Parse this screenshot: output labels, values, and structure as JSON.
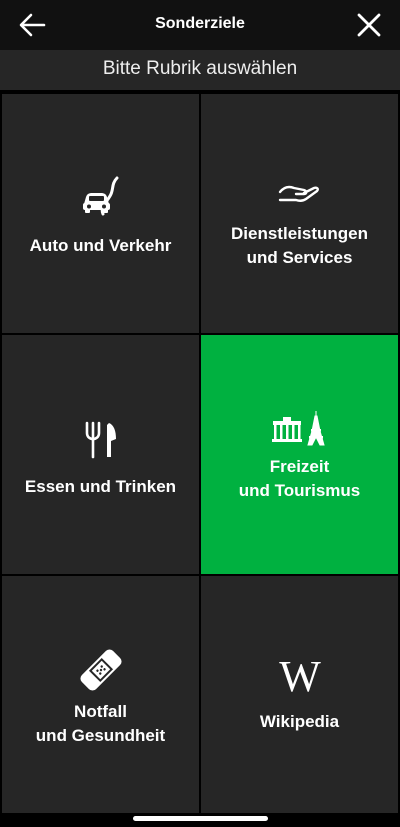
{
  "header": {
    "title": "Sonderziele",
    "back_icon": "arrow-left-icon",
    "close_icon": "close-icon"
  },
  "subtitle": "Bitte Rubrik auswählen",
  "tiles": [
    {
      "id": "auto",
      "icon": "car-road-icon",
      "lines": [
        "Auto und Verkehr"
      ],
      "active": false
    },
    {
      "id": "dienst",
      "icon": "hand-icon",
      "lines": [
        "Dienstleistungen",
        "und Services"
      ],
      "active": false
    },
    {
      "id": "essen",
      "icon": "fork-knife-icon",
      "lines": [
        "Essen und Trinken"
      ],
      "active": false
    },
    {
      "id": "freizeit",
      "icon": "landmarks-icon",
      "lines": [
        "Freizeit",
        "und Tourismus"
      ],
      "active": true
    },
    {
      "id": "notfall",
      "icon": "bandage-icon",
      "lines": [
        "Notfall",
        "und Gesundheit"
      ],
      "active": false
    },
    {
      "id": "wiki",
      "icon": "wikipedia-icon",
      "lines": [
        "Wikipedia"
      ],
      "active": false
    }
  ],
  "colors": {
    "tile": "#262626",
    "active_tile": "#00b140",
    "topbar": "#111111",
    "subtitle_bar": "#262626"
  }
}
